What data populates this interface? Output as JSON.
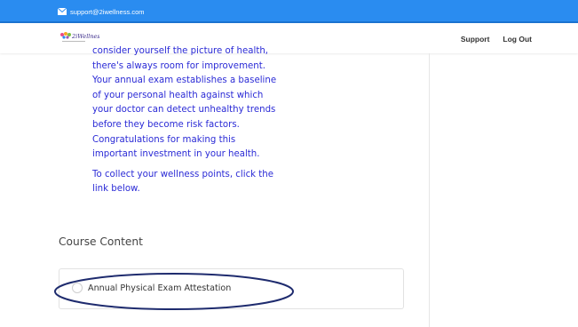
{
  "topbar": {
    "email": "support@2iwellness.com",
    "icon": "mail-icon"
  },
  "header": {
    "logo_text": "2iWellness",
    "nav": [
      {
        "label": "Support"
      },
      {
        "label": "Log Out"
      }
    ]
  },
  "content": {
    "paragraph_lines": [
      "consider yourself the picture of health,",
      "there's always room for improvement.",
      "Your annual exam establishes a baseline",
      "of your personal health against which",
      "your doctor can detect unhealthy trends",
      "before they become risk factors.",
      "Congratulations for making this",
      "important investment in your health."
    ],
    "cta_lines": [
      "To collect your wellness points, click the",
      "link below."
    ]
  },
  "course": {
    "title": "Course Content",
    "lessons": [
      {
        "label": "Annual Physical Exam Attestation",
        "completed": false
      }
    ]
  },
  "colors": {
    "topbar": "#2a8cf0",
    "body_text": "#2b2bd6",
    "annotation": "#1e2b6e"
  }
}
